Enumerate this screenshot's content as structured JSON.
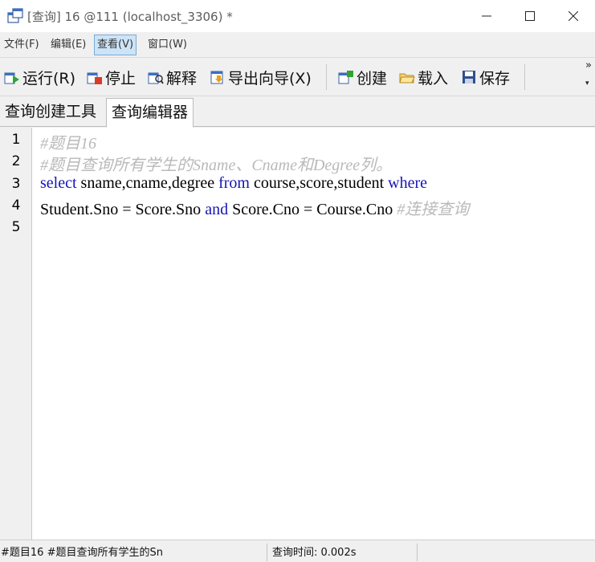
{
  "window": {
    "title": "[查询] 16 @111 (localhost_3306) *",
    "controls": {
      "minimize": "—",
      "maximize": "☐",
      "close": "✕"
    }
  },
  "menu": [
    {
      "label": "文件(F)",
      "active": false
    },
    {
      "label": "编辑(E)",
      "active": false
    },
    {
      "label": "查看(V)",
      "active": true
    },
    {
      "label": "窗口(W)",
      "active": false
    }
  ],
  "toolbar": {
    "run": {
      "label": "运行(R)",
      "icon": "run-icon"
    },
    "stop": {
      "label": "停止",
      "icon": "stop-icon"
    },
    "explain": {
      "label": "解释",
      "icon": "explain-icon"
    },
    "export": {
      "label": "导出向导(X)",
      "icon": "export-icon"
    },
    "create": {
      "label": "创建",
      "icon": "create-icon"
    },
    "load": {
      "label": "载入",
      "icon": "folder-icon"
    },
    "save": {
      "label": "保存",
      "icon": "save-icon"
    },
    "more": "»"
  },
  "tabs": [
    {
      "label": "查询创建工具",
      "active": false
    },
    {
      "label": "查询编辑器",
      "active": true
    }
  ],
  "editor": {
    "line_numbers": [
      "1",
      "2",
      "3",
      "4",
      "5"
    ],
    "lines": [
      {
        "comment": "#题目16"
      },
      {
        "comment": "#题目查询所有学生的Sname、Cname和Degree列。"
      },
      {
        "kw1": "select",
        "t1": " sname,cname,degree ",
        "kw2": "from",
        "t2": " course,score,student ",
        "kw3": "where"
      },
      {
        "t1": "Student.Sno = Score.Sno ",
        "kw1": "and",
        "t2": " Score.Cno = Course.Cno ",
        "comment": "#连接查询"
      },
      {}
    ]
  },
  "status": {
    "sql_preview": "#题目16 #题目查询所有学生的Sn",
    "query_time": "查询时间: 0.002s"
  },
  "colors": {
    "keyword": "#1515b5",
    "comment": "#b9b9b9",
    "menu_active_bg": "#cde4f7"
  }
}
